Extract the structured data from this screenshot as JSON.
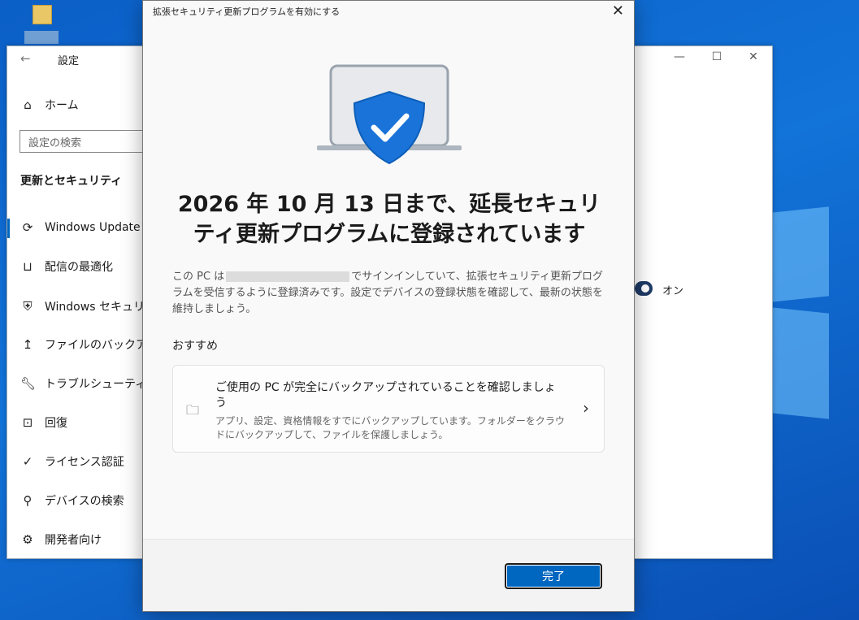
{
  "settings_window": {
    "title": "設定",
    "back_icon": "back-arrow-icon",
    "home_label": "ホーム",
    "search_placeholder": "設定の検索",
    "section_heading": "更新とセキュリティ",
    "nav_items": [
      {
        "label": "Windows Update",
        "icon": "refresh-icon",
        "selected": true
      },
      {
        "label": "配信の最適化",
        "icon": "delivery-icon"
      },
      {
        "label": "Windows セキュリティ",
        "icon": "shield-icon"
      },
      {
        "label": "ファイルのバックアップ",
        "icon": "upload-arrow-icon"
      },
      {
        "label": "トラブルシューティング",
        "icon": "wrench-icon"
      },
      {
        "label": "回復",
        "icon": "recovery-icon"
      },
      {
        "label": "ライセンス認証",
        "icon": "check-circle-icon"
      },
      {
        "label": "デバイスの検索",
        "icon": "person-location-icon"
      },
      {
        "label": "開発者向け",
        "icon": "developer-tools-icon"
      }
    ],
    "toggle_label": "オン",
    "accent_color": "#0067c0"
  },
  "dialog": {
    "title": "拡張セキュリティ更新プログラムを有効にする",
    "headline": "2026 年 10 月 13 日まで、延長セキュリティ更新プログラムに登録されています",
    "desc_before": "この PC は",
    "desc_after": "でサインインしていて、拡張セキュリティ更新プログラムを受信するように登録済みです。設定でデバイスの登録状態を確認して、最新の状態を維持しましょう。",
    "recommendation_heading": "おすすめ",
    "card": {
      "icon": "folder-icon",
      "title": "ご使用の PC が完全にバックアップされていることを確認しましょう",
      "body": "アプリ、設定、資格情報をすでにバックアップしています。フォルダーをクラウドにバックアップして、ファイルを保護しましょう。"
    },
    "done_label": "完了"
  }
}
